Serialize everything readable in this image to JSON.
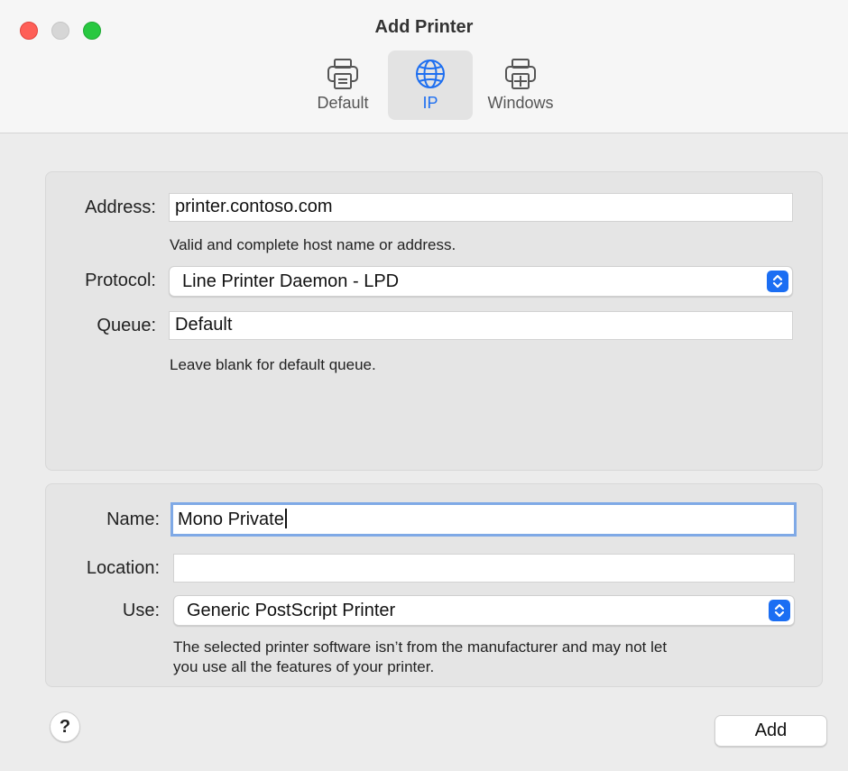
{
  "window": {
    "title": "Add Printer"
  },
  "tabs": [
    {
      "label": "Default",
      "icon": "printer-icon",
      "selected": false
    },
    {
      "label": "IP",
      "icon": "globe-icon",
      "selected": true
    },
    {
      "label": "Windows",
      "icon": "windows-printer-icon",
      "selected": false
    }
  ],
  "ip_panel": {
    "address_label": "Address:",
    "address_value": "printer.contoso.com",
    "address_hint": "Valid and complete host name or address.",
    "protocol_label": "Protocol:",
    "protocol_value": "Line Printer Daemon - LPD",
    "queue_label": "Queue:",
    "queue_value": "Default",
    "queue_hint": "Leave blank for default queue."
  },
  "details_panel": {
    "name_label": "Name:",
    "name_value": "Mono Private",
    "location_label": "Location:",
    "location_value": "",
    "use_label": "Use:",
    "use_value": "Generic PostScript Printer",
    "use_hint_line1": "The selected printer software isn’t from the manufacturer and may not let",
    "use_hint_line2": "you use all the features of your printer."
  },
  "footer": {
    "help_label": "?",
    "add_label": "Add"
  },
  "colors": {
    "accent": "#1b6ef3",
    "focus_ring": "#7fa9e6",
    "close": "#fe5f57",
    "zoom": "#28c840"
  }
}
